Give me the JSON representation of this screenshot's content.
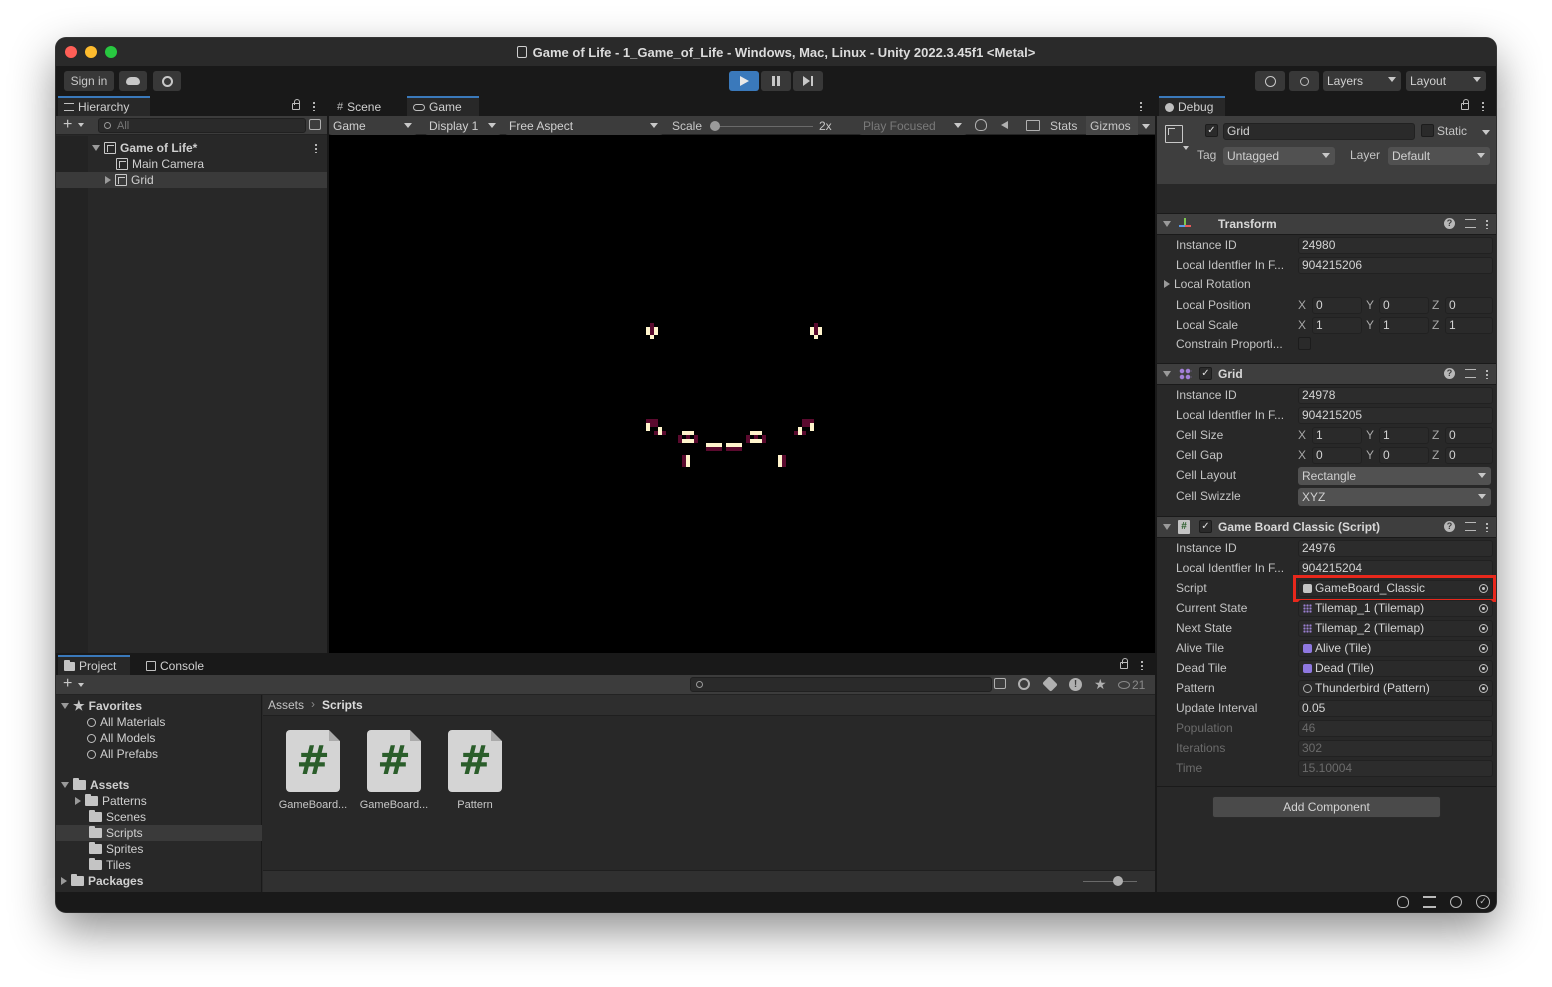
{
  "window": {
    "title": "Game of Life - 1_Game_of_Life - Windows, Mac, Linux - Unity 2022.3.45f1 <Metal>"
  },
  "toolbar": {
    "sign_in": "Sign in",
    "layers": "Layers",
    "layout": "Layout"
  },
  "hierarchy": {
    "tab": "Hierarchy",
    "search_placeholder": "All",
    "scene": "Game of Life*",
    "items": [
      "Main Camera",
      "Grid"
    ]
  },
  "game_view": {
    "tabs": [
      "Scene",
      "Game"
    ],
    "mode": "Game",
    "display": "Display 1",
    "aspect": "Free Aspect",
    "scale_label": "Scale",
    "scale_value": "2x",
    "play_focused": "Play Focused",
    "stats": "Stats",
    "gizmos": "Gizmos",
    "colors": {
      "background": "#000000",
      "alive": "#fff4cc",
      "edge": "#5a0a2e"
    }
  },
  "project": {
    "tabs": [
      "Project",
      "Console"
    ],
    "hidden_count": "21",
    "favorites": {
      "label": "Favorites",
      "items": [
        "All Materials",
        "All Models",
        "All Prefabs"
      ]
    },
    "assets": {
      "label": "Assets",
      "items": [
        "Patterns",
        "Scenes",
        "Scripts",
        "Sprites",
        "Tiles"
      ]
    },
    "packages": "Packages",
    "breadcrumb": [
      "Assets",
      "Scripts"
    ],
    "files": [
      "GameBoard...",
      "GameBoard...",
      "Pattern"
    ]
  },
  "inspector": {
    "tab": "Debug",
    "object_name": "Grid",
    "static_label": "Static",
    "tag_label": "Tag",
    "tag_value": "Untagged",
    "layer_label": "Layer",
    "layer_value": "Default",
    "transform": {
      "title": "Transform",
      "instance_id_label": "Instance ID",
      "instance_id": "24980",
      "local_id_label": "Local Identfier In F...",
      "local_id": "904215206",
      "local_rotation": "Local Rotation",
      "local_position": "Local Position",
      "position": [
        "0",
        "0",
        "0"
      ],
      "local_scale": "Local Scale",
      "scale": [
        "1",
        "1",
        "1"
      ],
      "constrain": "Constrain Proporti..."
    },
    "grid": {
      "title": "Grid",
      "instance_id_label": "Instance ID",
      "instance_id": "24978",
      "local_id_label": "Local Identfier In F...",
      "local_id": "904215205",
      "cell_size_label": "Cell Size",
      "cell_size": [
        "1",
        "1",
        "0"
      ],
      "cell_gap_label": "Cell Gap",
      "cell_gap": [
        "0",
        "0",
        "0"
      ],
      "cell_layout_label": "Cell Layout",
      "cell_layout": "Rectangle",
      "cell_swizzle_label": "Cell Swizzle",
      "cell_swizzle": "XYZ"
    },
    "script_comp": {
      "title": "Game Board Classic (Script)",
      "instance_id_label": "Instance ID",
      "instance_id": "24976",
      "local_id_label": "Local Identfier In F...",
      "local_id": "904215204",
      "script_label": "Script",
      "script": "GameBoard_Classic",
      "current_state_label": "Current State",
      "current_state": "Tilemap_1 (Tilemap)",
      "next_state_label": "Next State",
      "next_state": "Tilemap_2 (Tilemap)",
      "alive_tile_label": "Alive Tile",
      "alive_tile": "Alive (Tile)",
      "dead_tile_label": "Dead Tile",
      "dead_tile": "Dead (Tile)",
      "pattern_label": "Pattern",
      "pattern": "Thunderbird (Pattern)",
      "update_interval_label": "Update Interval",
      "update_interval": "0.05",
      "population_label": "Population",
      "population": "46",
      "iterations_label": "Iterations",
      "iterations": "302",
      "time_label": "Time",
      "time": "15.10004"
    },
    "add_component": "Add Component",
    "highlight_color": "#e8281c"
  },
  "axes": {
    "x": "X",
    "y": "Y",
    "z": "Z"
  }
}
